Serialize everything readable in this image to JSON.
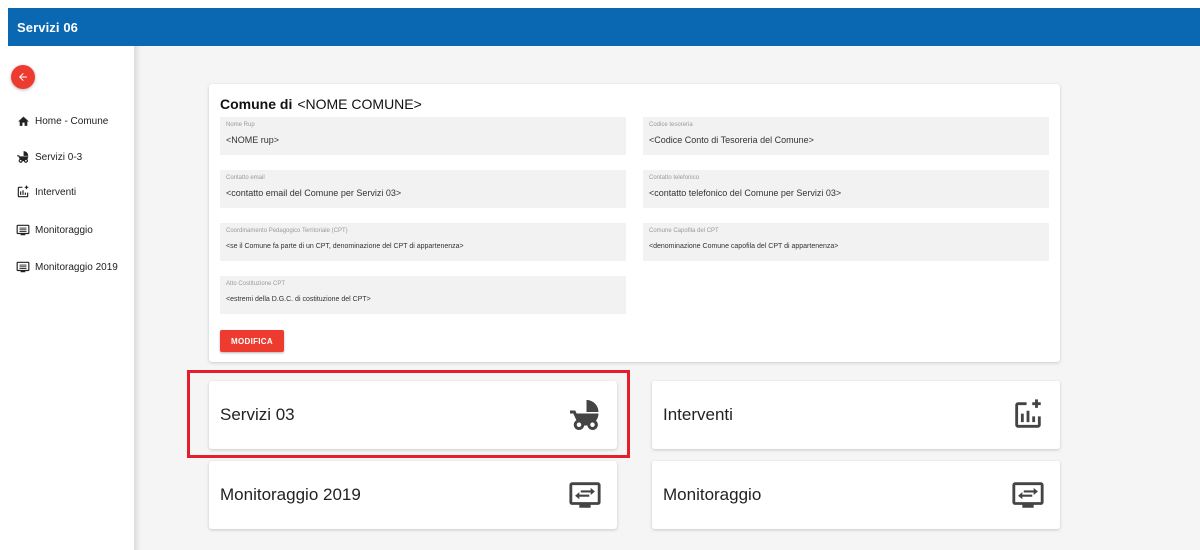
{
  "app": {
    "title": "Servizi 06"
  },
  "sidebar": {
    "items": [
      {
        "label": "Home - Comune",
        "icon": "home-icon"
      },
      {
        "label": "Servizi 0-3",
        "icon": "stroller-icon"
      },
      {
        "label": "Interventi",
        "icon": "interventi-icon"
      },
      {
        "label": "Monitoraggio",
        "icon": "monitor-icon"
      },
      {
        "label": "Monitoraggio 2019",
        "icon": "monitor-icon"
      }
    ]
  },
  "info": {
    "title_prefix": "Comune di",
    "title_name": "<NOME COMUNE>",
    "fields": [
      {
        "label": "Nome Rup",
        "value": "<NOME rup>"
      },
      {
        "label": "Codice tesoreria",
        "value": "<Codice Conto di Tesoreria del Comune>"
      },
      {
        "label": "Contatto email",
        "value": "<contatto email del Comune per Servizi 03>"
      },
      {
        "label": "Contatto telefonico",
        "value": "<contatto telefonico del Comune per Servizi 03>"
      },
      {
        "label": "Coordinamento Pedagogico Territoriale (CPT)",
        "value": "<se il Comune fa parte di un CPT, denominazione del CPT di appartenenza>"
      },
      {
        "label": "Comune Capofila del CPT",
        "value": "<denominazione Comune capofila del CPT di appartenenza>"
      },
      {
        "label": "Atto Costituzione CPT",
        "value": "<estremi della D.G.C. di costituzione del CPT>"
      }
    ],
    "edit_label": "MODIFICA"
  },
  "tiles": [
    {
      "label": "Servizi 03",
      "icon": "stroller-icon"
    },
    {
      "label": "Interventi",
      "icon": "interventi-icon"
    },
    {
      "label": "Monitoraggio 2019",
      "icon": "monitor-icon"
    },
    {
      "label": "Monitoraggio",
      "icon": "monitor-icon"
    }
  ],
  "colors": {
    "topbar": "#0a67b2",
    "accent": "#ee3b2f",
    "highlight": "#e41e2a"
  }
}
